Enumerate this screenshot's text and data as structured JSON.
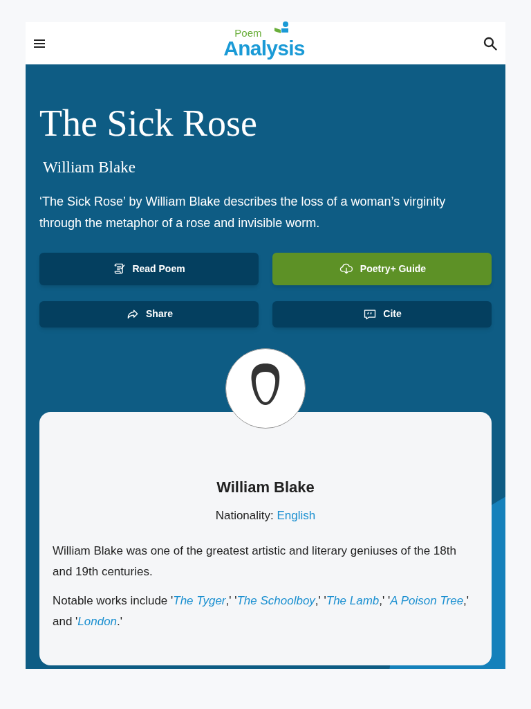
{
  "header": {
    "logo": {
      "small": "Poem",
      "large": "Analysis"
    }
  },
  "hero": {
    "title": "The Sick Rose",
    "author": "William Blake",
    "summary": "‘The Sick Rose’ by William Blake describes the loss of a woman’s virginity through the metaphor of a rose and invisible worm.",
    "buttons": [
      {
        "label": "Read Poem",
        "kind": "scroll",
        "highlighted": false
      },
      {
        "label": "Poetry+ Guide",
        "kind": "cloud",
        "highlighted": true
      },
      {
        "label": "Share",
        "kind": "share",
        "highlighted": false
      },
      {
        "label": "Cite",
        "kind": "quote",
        "highlighted": false
      }
    ]
  },
  "author_card": {
    "name": "William Blake",
    "nationality_label": "Nationality:",
    "nationality": "English",
    "bio": "William Blake was one of the greatest artistic and literary geniuses of the 18th and 19th centuries.",
    "notable_works": [
      {
        "kind": "text",
        "text": "Notable works include '"
      },
      {
        "kind": "link",
        "text": "The Tyger"
      },
      {
        "kind": "text",
        "text": ",' '"
      },
      {
        "kind": "link",
        "text": "The Schoolboy"
      },
      {
        "kind": "text",
        "text": ",' '"
      },
      {
        "kind": "link",
        "text": "The Lamb"
      },
      {
        "kind": "text",
        "text": ",' '"
      },
      {
        "kind": "link",
        "text": "A Poison Tree"
      },
      {
        "kind": "text",
        "text": ",' and '"
      },
      {
        "kind": "link",
        "text": "London"
      },
      {
        "kind": "text",
        "text": ".'"
      }
    ]
  }
}
